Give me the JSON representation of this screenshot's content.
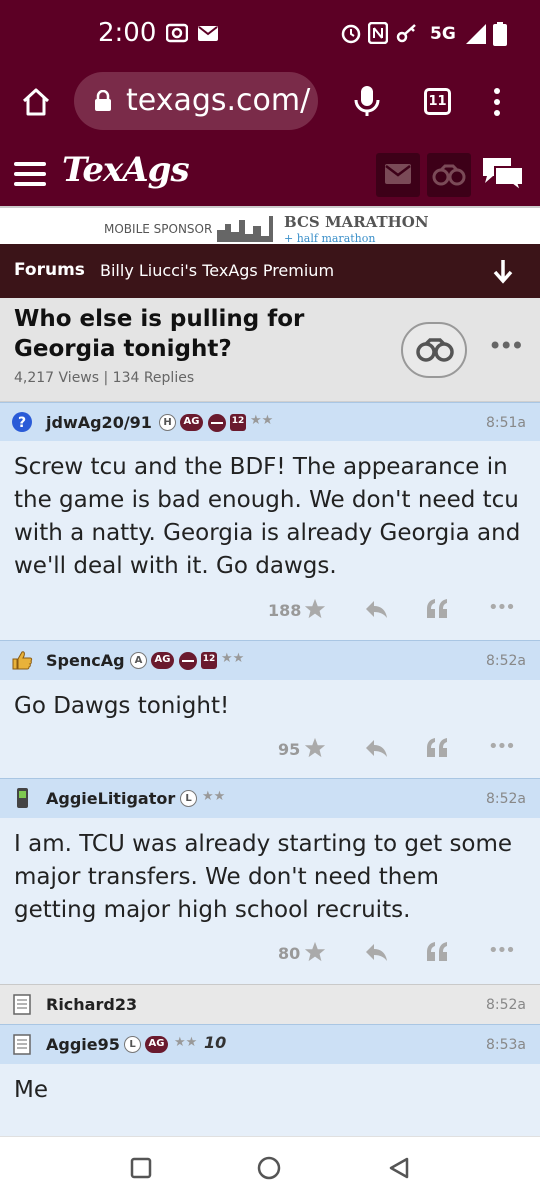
{
  "status_bar": {
    "time": "2:00",
    "network": "5G",
    "icons": [
      "camera-icon",
      "mail-icon",
      "alarm-icon",
      "nfc-icon",
      "key-icon",
      "signal-icon",
      "battery-icon"
    ]
  },
  "browser": {
    "url": "texags.com/",
    "tab_count": "11",
    "icons": [
      "home-icon",
      "lock-icon",
      "microphone-icon",
      "tabs-icon",
      "overflow-menu-icon"
    ]
  },
  "site": {
    "logo": "TexAgs",
    "icons": [
      "hamburger-icon",
      "mail-icon",
      "binoculars-icon",
      "chat-icon"
    ]
  },
  "sponsor": {
    "label": "MOBILE SPONSOR",
    "title": "BCS MARATHON",
    "subtitle": "+ half marathon"
  },
  "forum_bar": {
    "forums_label": "Forums",
    "forum_name": "Billy Liucci's TexAgs Premium"
  },
  "thread": {
    "title": "Who else is pulling for Georgia tonight?",
    "stats": "4,217 Views | 134 Replies"
  },
  "posts": [
    {
      "username": "jdwAg20/91",
      "time": "8:51a",
      "badges": [
        "H",
        "AG",
        "12"
      ],
      "stars_text": "★★",
      "text": "Screw tcu and the BDF! The appearance in the game is bad enough. We don't need tcu with a natty. Georgia is already Georgia and we'll deal with it. Go dawgs.",
      "star_count": "188"
    },
    {
      "username": "SpencAg",
      "time": "8:52a",
      "badges": [
        "A",
        "AG",
        "12"
      ],
      "stars_text": "★★",
      "text": "Go Dawgs tonight!",
      "star_count": "95"
    },
    {
      "username": "AggieLitigator",
      "time": "8:52a",
      "badges": [
        "L"
      ],
      "stars_text": "★★",
      "text": "I am. TCU was already starting to get some major transfers. We don't need them getting major high school recruits.",
      "star_count": "80"
    },
    {
      "username": "Richard23",
      "time": "8:52a"
    },
    {
      "username": "Aggie95",
      "time": "8:53a",
      "badges": [
        "L",
        "AG"
      ],
      "stars_text": "★★",
      "extra_badge": "10",
      "text": "Me"
    }
  ],
  "colors": {
    "brand_maroon": "#5c0025",
    "forum_bar": "#3b1418",
    "post_header_blue": "#cce0f5",
    "post_body_blue": "#e6eff9"
  }
}
